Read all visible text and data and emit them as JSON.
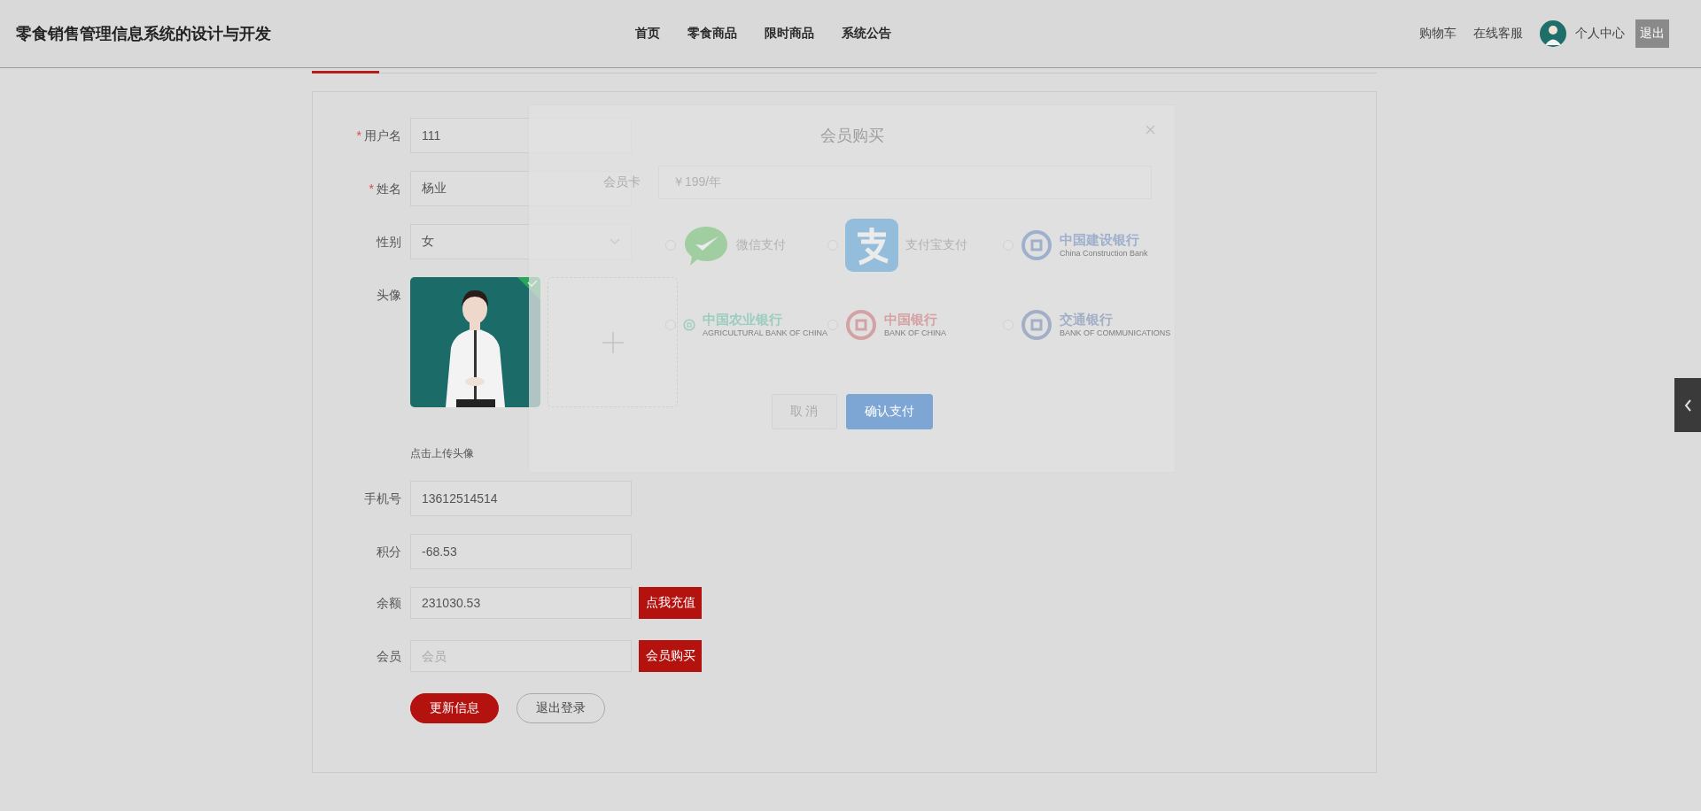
{
  "header": {
    "title": "零食销售管理信息系统的设计与开发",
    "nav": [
      {
        "label": "首页"
      },
      {
        "label": "零食商品"
      },
      {
        "label": "限时商品"
      },
      {
        "label": "系统公告"
      }
    ],
    "links": [
      {
        "label": "购物车"
      },
      {
        "label": "在线客服"
      }
    ],
    "profile": "个人中心",
    "logout": "退出"
  },
  "form": {
    "fields": [
      {
        "kind": "text",
        "required_mark": "*",
        "label": "用户名",
        "value": "111"
      },
      {
        "kind": "text",
        "required_mark": "*",
        "label": "姓名",
        "value": "杨业"
      },
      {
        "kind": "select",
        "label": "性别",
        "value": "女"
      },
      {
        "kind": "avatar",
        "label": "头像",
        "uploaded": true,
        "hint": "点击上传头像"
      },
      {
        "kind": "text",
        "label": "手机号",
        "value": "13612514514"
      },
      {
        "kind": "text",
        "label": "积分",
        "value": "-68.53"
      },
      {
        "kind": "action",
        "label": "余额",
        "value": "231030.53",
        "button": "点我充值"
      },
      {
        "kind": "action",
        "label": "会员",
        "placeholder": "会员",
        "button": "会员购买"
      }
    ],
    "buttons": [
      {
        "label": "更新信息",
        "primary": true
      },
      {
        "label": "退出登录",
        "primary": false
      }
    ]
  },
  "dialog": {
    "title": "会员购买",
    "card_label": "会员卡",
    "card_value": "￥199/年",
    "payments": [
      {
        "kind": "wechat",
        "label": "微信支付",
        "selected": false
      },
      {
        "kind": "alipay",
        "label": "支付宝支付",
        "selected": false
      },
      {
        "kind": "bank",
        "label": "中国建设银行",
        "sub": "China Construction Bank",
        "color": "#9fb0cc",
        "selected": false
      },
      {
        "kind": "bank",
        "label": "中国农业银行",
        "sub": "AGRICULTURAL BANK OF CHINA",
        "color": "#9ccdbf",
        "selected": false
      },
      {
        "kind": "bank",
        "label": "中国银行",
        "sub": "BANK OF CHINA",
        "color": "#d4a2a4",
        "selected": false
      },
      {
        "kind": "bank",
        "label": "交通银行",
        "sub": "BANK OF COMMUNICATIONS",
        "color": "#a3afc6",
        "selected": false
      }
    ],
    "buttons": [
      {
        "label": "取 消",
        "primary": false
      },
      {
        "label": "确认支付",
        "primary": true
      }
    ]
  }
}
